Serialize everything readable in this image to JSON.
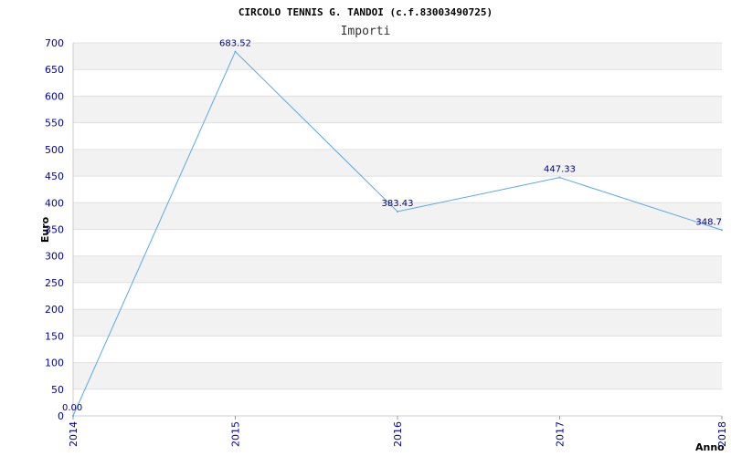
{
  "chart_data": {
    "type": "line",
    "title": "CIRCOLO TENNIS G. TANDOI (c.f.83003490725)",
    "subtitle": "Importi",
    "xlabel": "Anno",
    "ylabel": "Euro",
    "x": [
      "2014",
      "2015",
      "2016",
      "2017",
      "2018"
    ],
    "series": [
      {
        "values": [
          0.0,
          683.52,
          383.43,
          447.33,
          348.7
        ],
        "labels": [
          "0.00",
          "683.52",
          "383.43",
          "447.33",
          "348.7"
        ]
      }
    ],
    "ylim": [
      0,
      700
    ],
    "yticks": [
      "0",
      "50",
      "100",
      "150",
      "200",
      "250",
      "300",
      "350",
      "400",
      "450",
      "500",
      "550",
      "600",
      "650",
      "700"
    ],
    "grid": "horizontal bands",
    "colors": {
      "line": "#5aa9e6",
      "band": "#f2f2f2",
      "tick": "#0000aa"
    }
  }
}
